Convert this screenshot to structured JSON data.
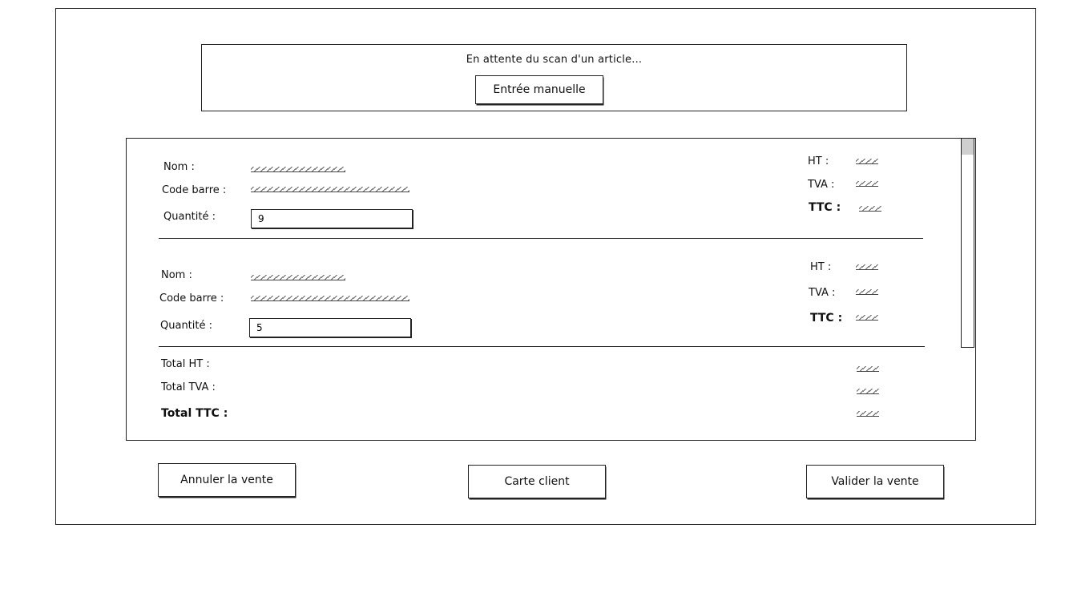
{
  "scan": {
    "status_text": "En attente du scan d'un article...",
    "manual_entry_label": "Entrée manuelle"
  },
  "labels": {
    "name": "Nom :",
    "barcode": "Code barre :",
    "quantity": "Quantité :",
    "ht": "HT :",
    "tva": "TVA :",
    "ttc": "TTC :"
  },
  "items": [
    {
      "quantity": "9"
    },
    {
      "quantity": "5"
    }
  ],
  "totals": {
    "total_ht_label": "Total HT :",
    "total_tva_label": "Total TVA :",
    "total_ttc_label": "Total TTC :"
  },
  "actions": {
    "cancel_label": "Annuler la vente",
    "client_card_label": "Carte client",
    "validate_label": "Valider la vente"
  }
}
